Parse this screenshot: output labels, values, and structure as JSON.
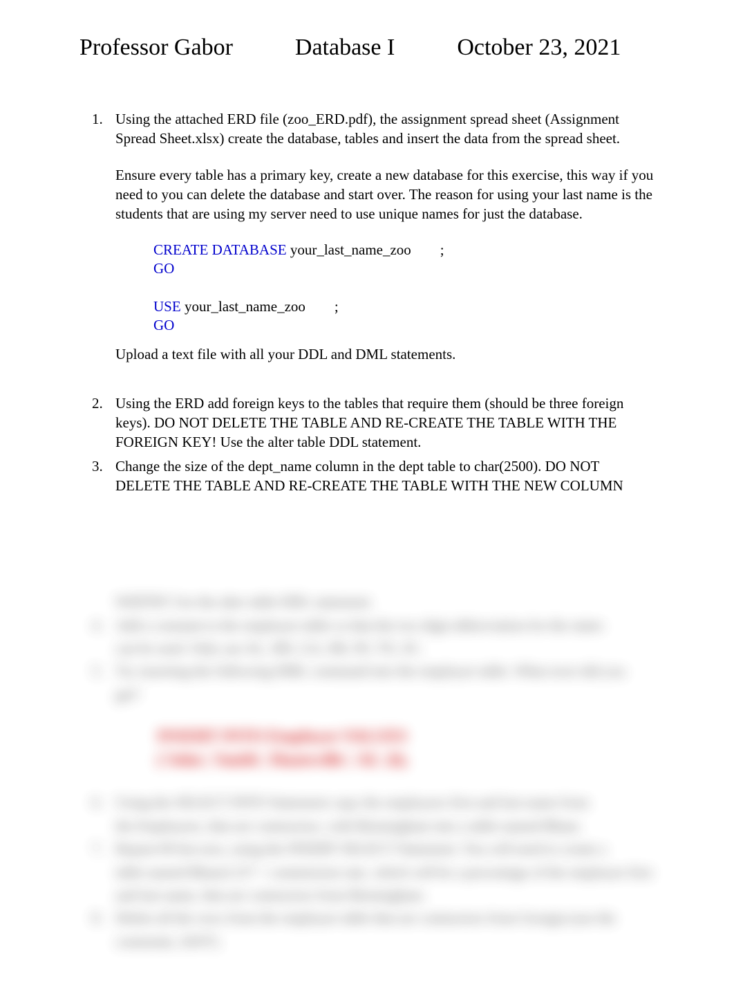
{
  "header": {
    "professor": "Professor Gabor",
    "course": "Database I",
    "date": "October 23, 2021"
  },
  "items": [
    {
      "intro": "Using the attached ERD file (zoo_ERD.pdf), the assignment spread sheet (Assignment Spread Sheet.xlsx) create the database, tables and insert the data from the spread sheet.",
      "para2": "Ensure every table has a primary key, create a new database for this exercise, this way if you need to you can delete the database and start over. The reason for using your last name is the students that are using my server need to use unique names for just the database.",
      "code": {
        "line1_kw": "CREATE DATABASE",
        "line1_arg": " your_last_name_zoo        ;",
        "line2_kw": "GO",
        "line3_kw": "USE",
        "line3_arg": " your_last_name_zoo        ;",
        "line4_kw": "GO"
      },
      "upload": "Upload a text file with all your DDL and DML statements."
    },
    {
      "text": "Using the ERD add foreign keys to the tables that require them (should be three foreign keys). DO NOT DELETE THE TABLE AND RE-CREATE THE TABLE WITH THE FOREIGN KEY! Use the alter table DDL statement."
    },
    {
      "text": "Change the size of the dept_name column in the dept table to char(2500). DO NOT DELETE THE TABLE AND RE-CREATE THE TABLE WITH THE NEW COLUMN"
    }
  ],
  "blurred": {
    "l1": "WIDTH! Use the alter table DDL statement.",
    "l2": "Add a constant to the employee table so that the two digit abbreviation for the states",
    "l3": "can be used. Only use AL, MS, GA, MI, IN, TX, SC.",
    "l4": "Try inserting the following DML command into the employee table. What error did you",
    "l5": "get?",
    "red": "INSERT INTO Employee VALUES ('John','Smith','Huntsville','AL',0);",
    "l6": "Using the SELECT INTO Statement copy the employees first and last name from",
    "l7": "the Employees, that are contractors, with Birmingham into a table named Bham.",
    "l8": "Repeat #6 but now, using the INSERT SELECT Statement. You will need to create a",
    "l9": "table named Bham2 (37 + commission rate, which will be a percentage of the employee first",
    "l10": "and last name, that are contractors from Birmingham.",
    "l11": "Delete all the rows from the employee table that are contractors from Georgia (use the",
    "l12": "constraint, 26/07)."
  }
}
